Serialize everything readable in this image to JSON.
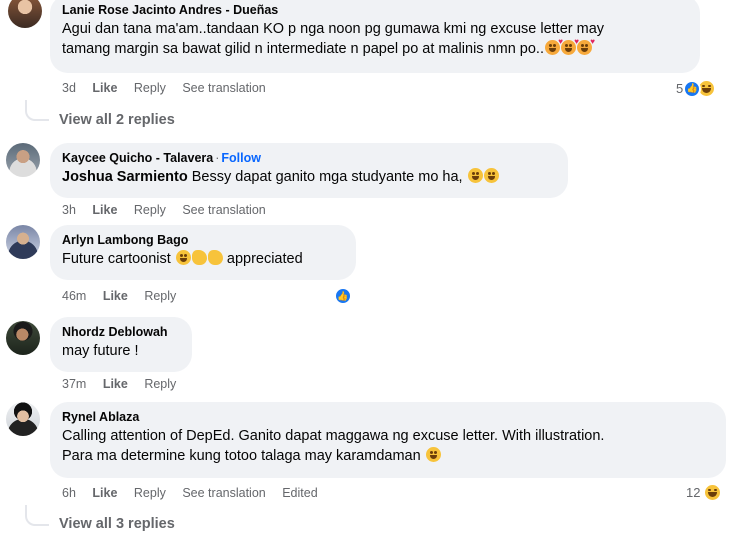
{
  "comments": [
    {
      "author": "Lanie Rose Jacinto Andres - Dueñas",
      "text_line1": "Agui dan tana ma'am..tandaan KO p nga noon pg gumawa kmi ng excuse letter may",
      "text_line2": "tamang margin sa bawat gilid n intermediate n papel po at malinis nmn po..",
      "emojis": [
        "smiling-face-with-hearts",
        "smiling-face-with-hearts",
        "smiling-face-with-hearts"
      ],
      "time": "3d",
      "like": "Like",
      "reply": "Reply",
      "see_translation": "See translation",
      "reaction_count": "5",
      "reaction_icons": [
        "like-reaction",
        "haha-reaction"
      ]
    },
    {
      "author": "Kaycee Quicho - Talavera",
      "follow": "Follow",
      "mention": "Joshua Sarmiento",
      "text": "Bessy dapat ganito mga studyante mo ha,",
      "emojis": [
        "rolling-on-floor-laughing",
        "rolling-on-floor-laughing"
      ],
      "time": "3h",
      "like": "Like",
      "reply": "Reply",
      "see_translation": "See translation"
    },
    {
      "author": "Arlyn Lambong Bago",
      "text": "Future cartoonist",
      "emojis": [
        "face-with-tears-of-joy",
        "clapping-hands",
        "clapping-hands"
      ],
      "text_after": "appreciated",
      "time": "46m",
      "like": "Like",
      "reply": "Reply",
      "reaction_icons": [
        "like-reaction"
      ]
    },
    {
      "author": "Nhordz Deblowah",
      "text": "may future !",
      "time": "37m",
      "like": "Like",
      "reply": "Reply"
    },
    {
      "author": "Rynel Ablaza",
      "text_line1": "Calling attention of DepEd. Ganito dapat maggawa ng excuse letter. With illustration.",
      "text_line2": "Para ma determine kung totoo talaga may karamdaman",
      "emojis": [
        "rolling-on-floor-laughing"
      ],
      "time": "6h",
      "like": "Like",
      "reply": "Reply",
      "see_translation": "See translation",
      "edited": "Edited",
      "reaction_count": "12",
      "reaction_icons": [
        "haha-reaction"
      ]
    }
  ],
  "view_replies": [
    "View all 2 replies",
    "View all 3 replies"
  ],
  "colors": {
    "bubble": "#f0f2f5",
    "secondary_text": "#65676b",
    "follow_link": "#0866ff",
    "like_blue": "#1877f2"
  }
}
